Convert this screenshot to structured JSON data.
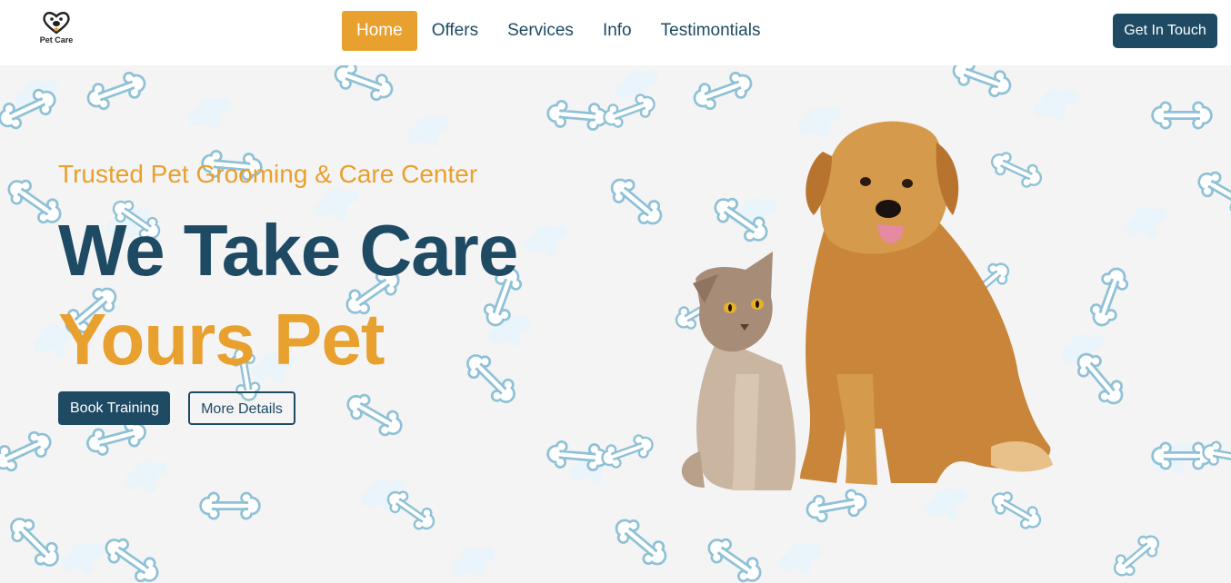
{
  "brand": {
    "name": "Pet Care"
  },
  "nav": {
    "items": [
      {
        "label": "Home",
        "active": true
      },
      {
        "label": "Offers",
        "active": false
      },
      {
        "label": "Services",
        "active": false
      },
      {
        "label": "Info",
        "active": false
      },
      {
        "label": "Testimontials",
        "active": false
      }
    ],
    "cta_label": "Get In Touch"
  },
  "hero": {
    "subtitle": "Trusted Pet Grooming & Care Center",
    "headline_line1": "We Take Care",
    "headline_line2": "Yours Pet",
    "primary_button": "Book Training",
    "secondary_button": "More Details",
    "image": "cat-and-golden-retriever-photo"
  },
  "colors": {
    "primary": "#1e4a64",
    "accent": "#e8a02e",
    "background": "#f4f4f4",
    "pattern": "#8fc1d6"
  },
  "icons": [
    "paw-heart-logo-icon",
    "bone-icon"
  ]
}
